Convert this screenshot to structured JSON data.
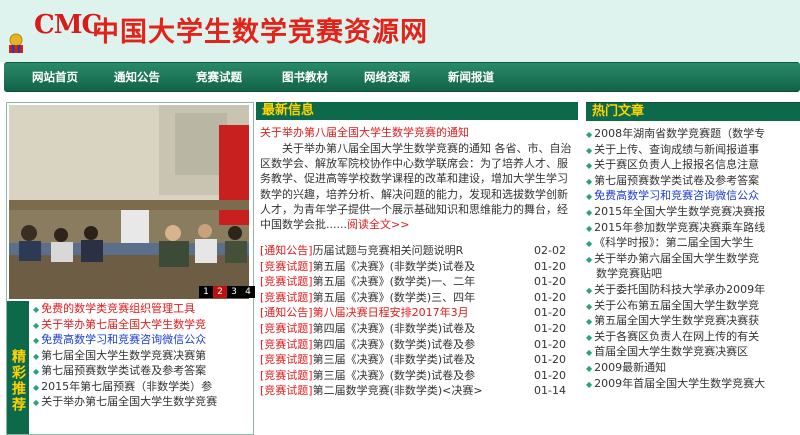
{
  "header": {
    "logo_text": "CMC",
    "site_title": "中国大学生数学竞赛资源网"
  },
  "nav": [
    "网站首页",
    "通知公告",
    "竞赛试题",
    "图书教材",
    "网络资源",
    "新闻报道"
  ],
  "slideshow": {
    "numbers": [
      "1",
      "2",
      "3",
      "4"
    ],
    "active": 2
  },
  "jingcai": {
    "label": "精彩推荐"
  },
  "left_links": [
    {
      "text": "免费的数学类竞赛组织管理工具",
      "color": "red"
    },
    {
      "text": "关于举办第七届全国大学生数学竞",
      "color": "red"
    },
    {
      "text": "免费高数学习和竞赛咨询微信公众",
      "color": "blue"
    },
    {
      "text": "第七届全国大学生数学竞赛决赛第",
      "color": "dark"
    },
    {
      "text": "第七届预赛数学类试卷及参考答案",
      "color": "dark"
    },
    {
      "text": "2015年第七届预赛（非数学类）参",
      "color": "dark"
    },
    {
      "text": "关于举办第七届全国大学生数学竞赛",
      "color": "dark"
    }
  ],
  "latest": {
    "heading": "最新信息",
    "title": "关于举办第八届全国大学生数学竞赛的通知",
    "body": "关于举办第八届全国大学生数学竞赛的通知 各省、市、自治区数学会、解放军院校协作中心数学联席会：为了培养人才、服务教学、促进高等学校数学课程的改革和建设，增加大学生学习数学的兴趣，培养分析、解决问题的能力，发现和选拔数学创新人才，为青年学子提供一个展示基础知识和思维能力的舞台，经中国数学会批......",
    "more": "阅读全文>>",
    "items": [
      {
        "cat": "[通知公告]",
        "title": "历届试题与竞赛相关问题说明R",
        "date": "02-02",
        "hl": false
      },
      {
        "cat": "[竞赛试题]",
        "title": "第五届《决赛》(非数学类)试卷及",
        "date": "01-20",
        "hl": false
      },
      {
        "cat": "[竞赛试题]",
        "title": "第五届《决赛》(数学类)一、二年",
        "date": "01-20",
        "hl": false
      },
      {
        "cat": "[竞赛试题]",
        "title": "第五届《决赛》(数学类)三、四年",
        "date": "01-20",
        "hl": false
      },
      {
        "cat": "[通知公告]",
        "title": "第八届决赛日程安排2017年3月",
        "date": "01-20",
        "hl": true
      },
      {
        "cat": "[竞赛试题]",
        "title": "第四届《决赛》(非数学类)试卷及",
        "date": "01-20",
        "hl": false
      },
      {
        "cat": "[竞赛试题]",
        "title": "第四届《决赛》(数学类)试卷及参",
        "date": "01-20",
        "hl": false
      },
      {
        "cat": "[竞赛试题]",
        "title": "第三届《决赛》(非数学类)试卷及",
        "date": "01-20",
        "hl": false
      },
      {
        "cat": "[竞赛试题]",
        "title": "第三届《决赛》(数学类)试卷及参",
        "date": "01-20",
        "hl": false
      },
      {
        "cat": "[竞赛试题]",
        "title": "第二届数学竞赛(非数学类)<决赛>",
        "date": "01-14",
        "hl": false
      }
    ]
  },
  "hot": {
    "heading": "热门文章",
    "items": [
      {
        "text": "2008年湖南省数学竞赛题（数学专",
        "blue": false,
        "indent": false
      },
      {
        "text": "关于上传、查询成绩与新闻报道事",
        "blue": false,
        "indent": false
      },
      {
        "text": "关于赛区负责人上报报名信息注意",
        "blue": false,
        "indent": false
      },
      {
        "text": "第七届预赛数学类试卷及参考答案",
        "blue": false,
        "indent": false
      },
      {
        "text": "免费高数学习和竞赛咨询微信公众",
        "blue": true,
        "indent": false
      },
      {
        "text": "2015年全国大学生数学竞赛决赛报",
        "blue": false,
        "indent": false
      },
      {
        "text": "2015年参加数学竞赛决赛乘车路线",
        "blue": false,
        "indent": false
      },
      {
        "text": "《科学时报》：第二届全国大学生",
        "blue": false,
        "indent": false
      },
      {
        "text": "关于举办第六届全国大学生数学竞",
        "blue": false,
        "indent": false
      },
      {
        "text": "数学竞赛贴吧",
        "blue": false,
        "indent": true
      },
      {
        "text": "关于委托国防科技大学承办2009年",
        "blue": false,
        "indent": false
      },
      {
        "text": "关于公布第五届全国大学生数学竞",
        "blue": false,
        "indent": false
      },
      {
        "text": "第五届全国大学生数学竞赛决赛获",
        "blue": false,
        "indent": false
      },
      {
        "text": "关于各赛区负责人在网上传的有关",
        "blue": false,
        "indent": false
      },
      {
        "text": "首届全国大学生数学竞赛决赛区",
        "blue": false,
        "indent": false
      },
      {
        "text": "2009最新通知",
        "blue": false,
        "indent": false
      },
      {
        "text": "2009年首届全国大学生数学竞赛大",
        "blue": false,
        "indent": false
      }
    ]
  }
}
